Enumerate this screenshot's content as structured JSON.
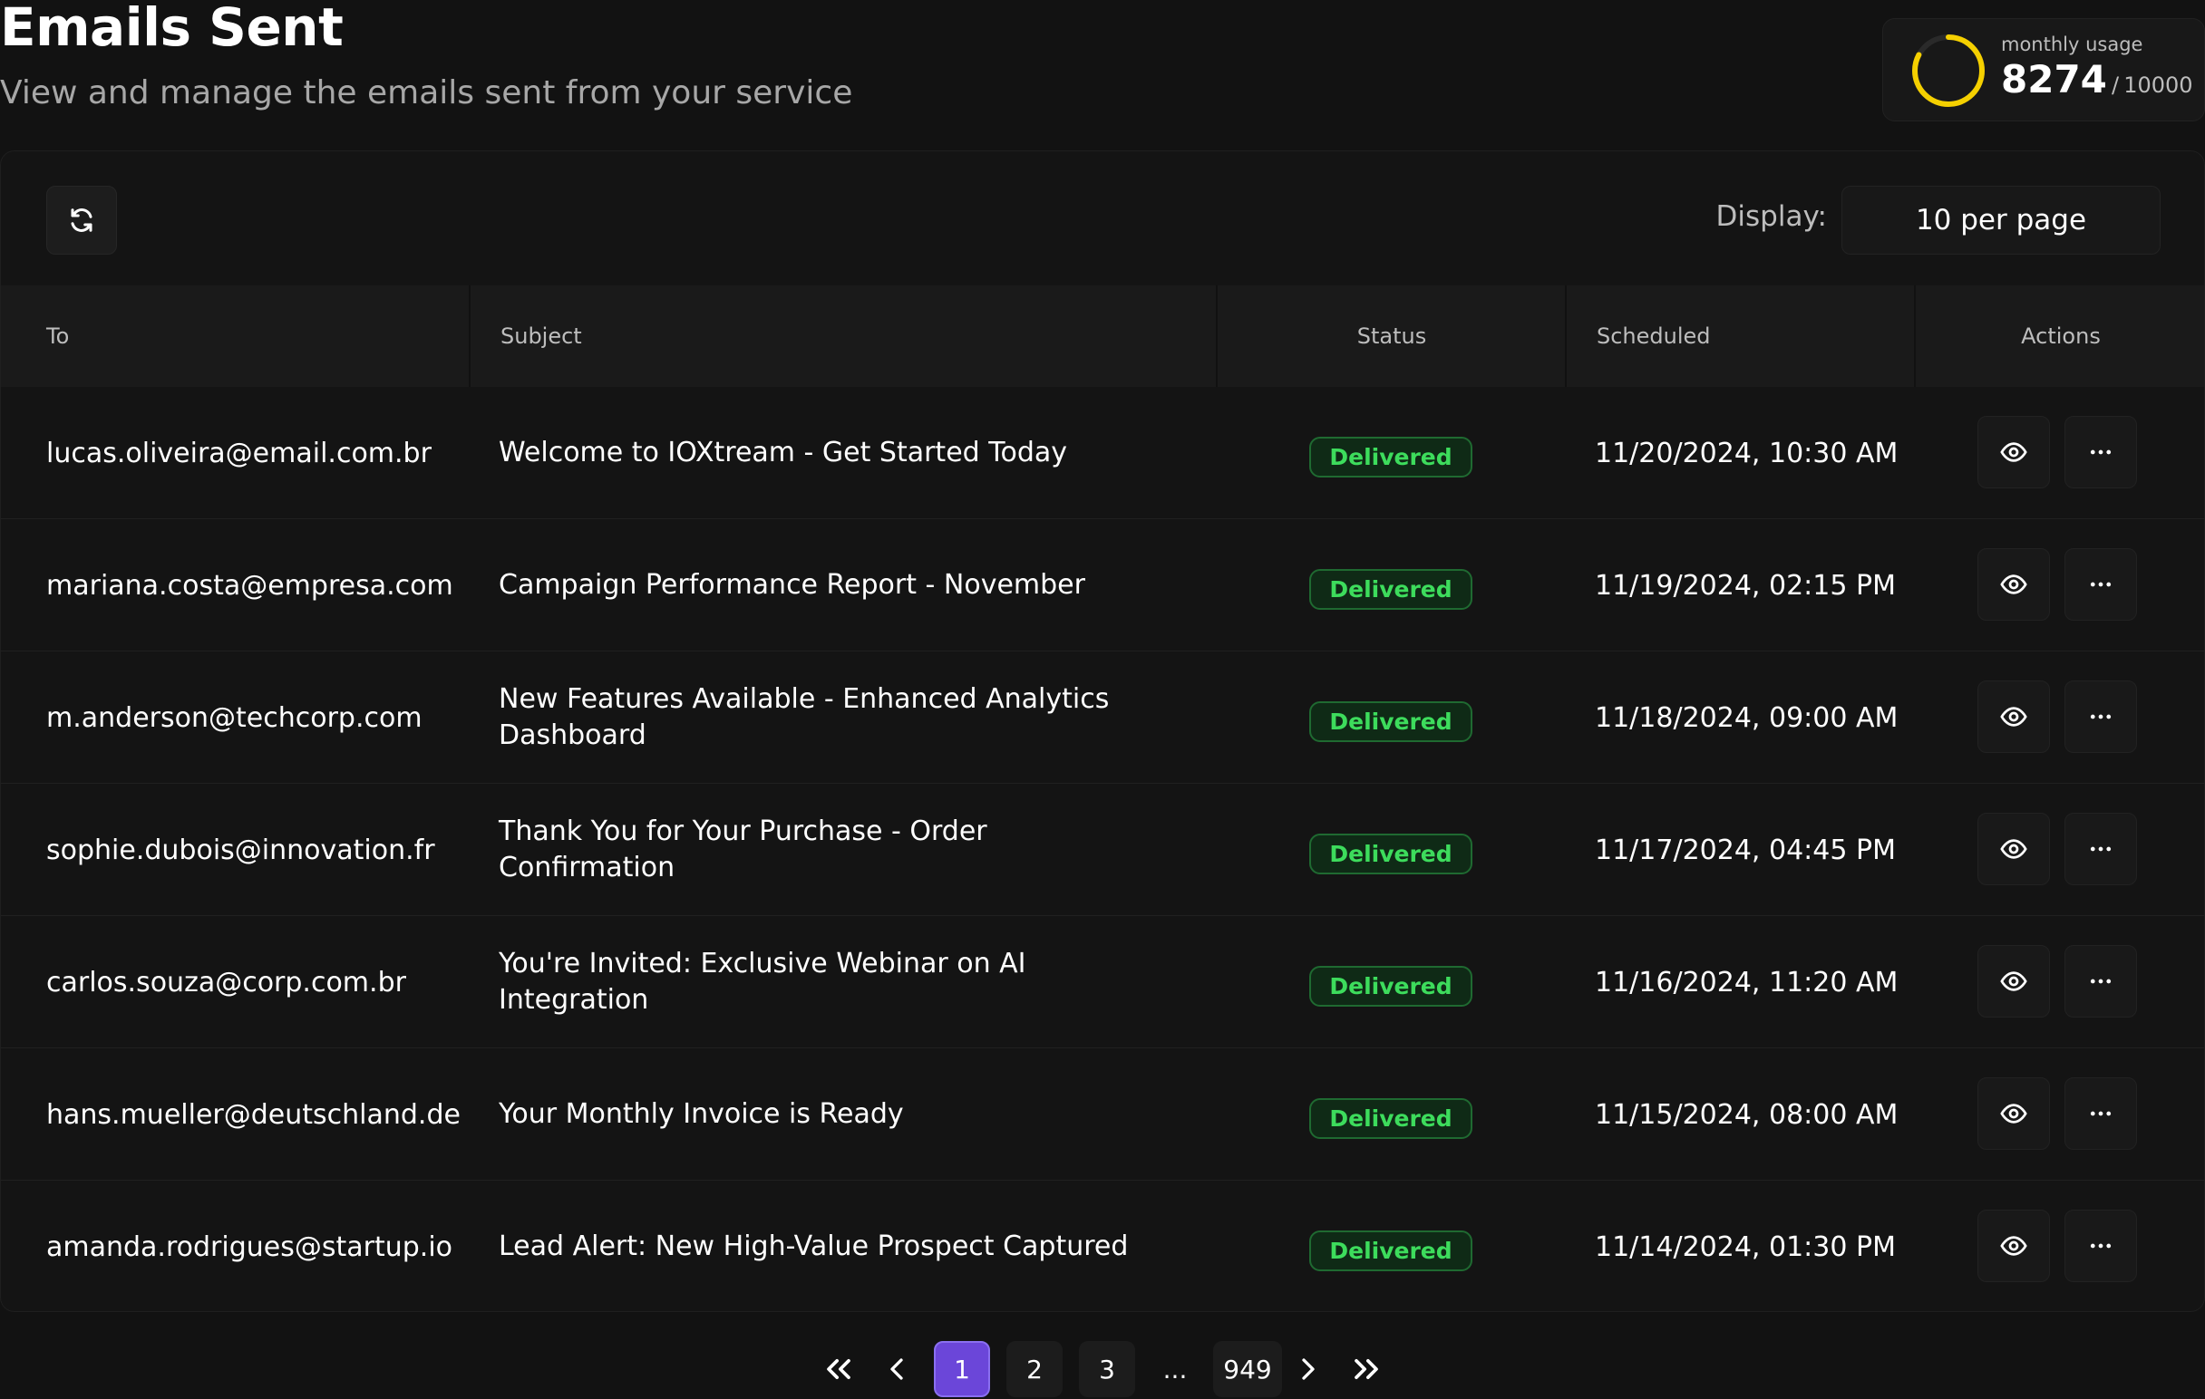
{
  "header": {
    "title": "Emails Sent",
    "subtitle": "View and manage the emails sent from your service"
  },
  "usage": {
    "label": "monthly usage",
    "current": "8274",
    "separator": "/",
    "limit": "10000",
    "fraction": 0.8274,
    "ring_color": "#f5d000"
  },
  "toolbar": {
    "refresh_icon": "refresh-icon",
    "display_label": "Display:",
    "per_page": "10 per page"
  },
  "table": {
    "columns": {
      "to": "To",
      "subject": "Subject",
      "status": "Status",
      "scheduled": "Scheduled",
      "actions": "Actions"
    },
    "rows": [
      {
        "to": "lucas.oliveira@email.com.br",
        "subject": "Welcome to IOXtream - Get Started Today",
        "status": "Delivered",
        "scheduled": "11/20/2024, 10:30 AM"
      },
      {
        "to": "mariana.costa@empresa.com",
        "subject": "Campaign Performance Report - November",
        "status": "Delivered",
        "scheduled": "11/19/2024, 02:15 PM"
      },
      {
        "to": "m.anderson@techcorp.com",
        "subject": "New Features Available - Enhanced Analytics Dashboard",
        "status": "Delivered",
        "scheduled": "11/18/2024, 09:00 AM"
      },
      {
        "to": "sophie.dubois@innovation.fr",
        "subject": "Thank You for Your Purchase - Order Confirmation",
        "status": "Delivered",
        "scheduled": "11/17/2024, 04:45 PM"
      },
      {
        "to": "carlos.souza@corp.com.br",
        "subject": "You're Invited: Exclusive Webinar on AI Integration",
        "status": "Delivered",
        "scheduled": "11/16/2024, 11:20 AM"
      },
      {
        "to": "hans.mueller@deutschland.de",
        "subject": "Your Monthly Invoice is Ready",
        "status": "Delivered",
        "scheduled": "11/15/2024, 08:00 AM"
      },
      {
        "to": "amanda.rodrigues@startup.io",
        "subject": "Lead Alert: New High-Value Prospect Captured",
        "status": "Delivered",
        "scheduled": "11/14/2024, 01:30 PM"
      }
    ],
    "status_color": "#3ddc5c",
    "row_actions": [
      "eye-icon",
      "more-horizontal-icon"
    ]
  },
  "pagination": {
    "first_icon": "chevrons-left-icon",
    "prev_icon": "chevron-left-icon",
    "pages": [
      "1",
      "2",
      "3"
    ],
    "ellipsis": "...",
    "last_page": "949",
    "current": "1",
    "next_icon": "chevron-right-icon",
    "last_icon": "chevrons-right-icon",
    "accent": "#6b46d9"
  }
}
